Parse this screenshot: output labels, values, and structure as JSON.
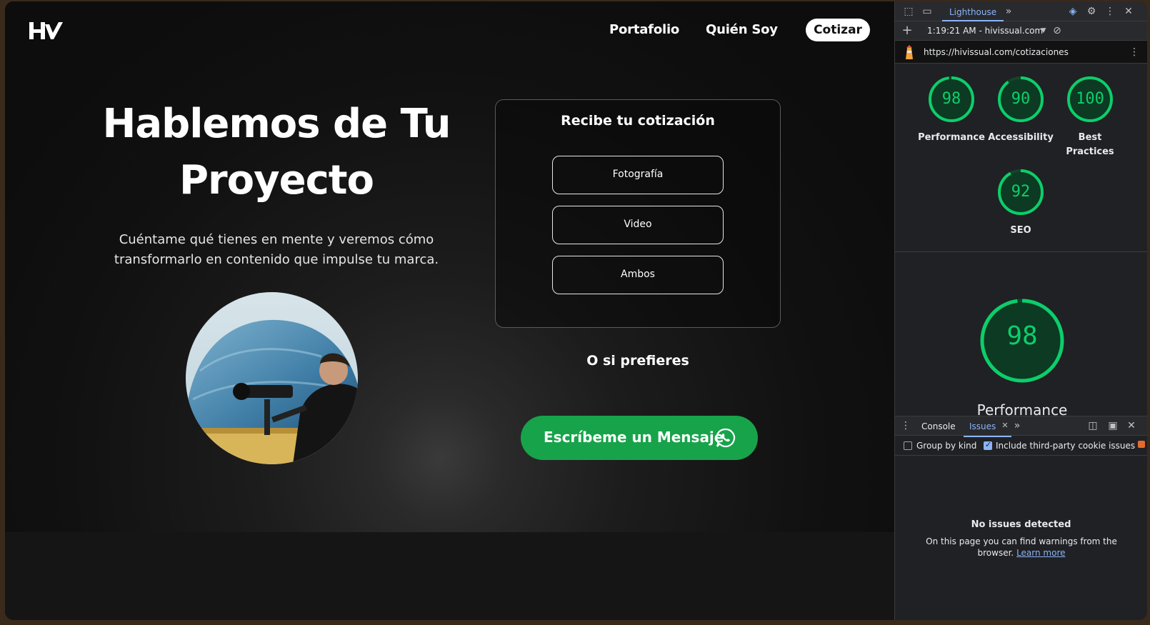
{
  "site": {
    "brand": "HV",
    "nav": {
      "portfolio": "Portafolio",
      "about": "Quién Soy",
      "cta": "Cotizar"
    },
    "hero": {
      "title_line1": "Hablemos de Tu",
      "title_line2": "Proyecto",
      "subtitle_line1": "Cuéntame qué tienes en mente y veremos cómo",
      "subtitle_line2": "transformarlo en contenido que impulse tu marca."
    },
    "quote": {
      "title": "Recibe tu cotización",
      "options": [
        "Fotografía",
        "Video",
        "Ambos"
      ]
    },
    "or_text": "O si prefieres",
    "whatsapp_button": "Escríbeme un Mensaje",
    "colors": {
      "whatsapp_green": "#17a34a",
      "background": "#121212"
    }
  },
  "devtools": {
    "active_tab": "Lighthouse",
    "report_selector": "1:19:21 AM - hivissual.com",
    "audited_url": "https://hivissual.com/cotizaciones",
    "scores": [
      {
        "label": "Performance",
        "value": 98
      },
      {
        "label": "Accessibility",
        "value": 90
      },
      {
        "label": "Best Practices",
        "value": 100
      },
      {
        "label": "SEO",
        "value": 92
      }
    ],
    "featured_score": {
      "label": "Performance",
      "value": 98
    },
    "drawer": {
      "tabs": [
        "Console",
        "Issues"
      ],
      "active_tab": "Issues",
      "group_by_kind": "Group by kind",
      "include_third_party": "Include third-party cookie issues",
      "group_by_kind_checked": false,
      "include_third_party_checked": true,
      "empty_title": "No issues detected",
      "empty_body": "On this page you can find warnings from the browser.",
      "learn_more": "Learn more"
    },
    "colors": {
      "score_green": "#0cce6b",
      "accent": "#8ab4f8"
    }
  }
}
